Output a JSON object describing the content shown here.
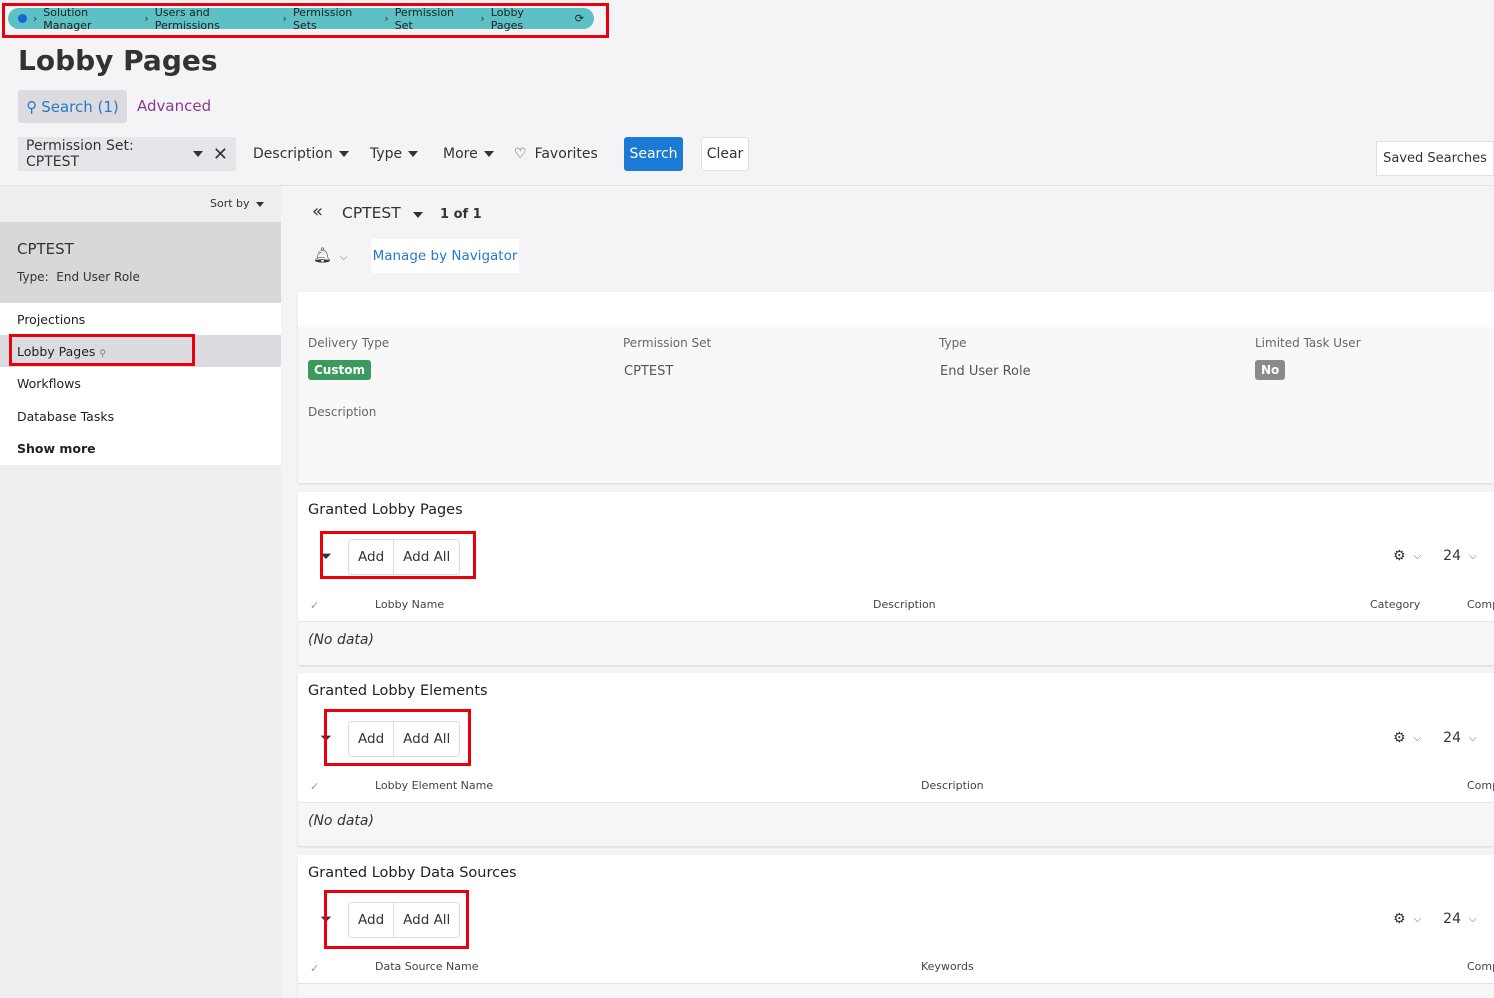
{
  "breadcrumb": [
    "Solution Manager",
    "Users and Permissions",
    "Permission Sets",
    "Permission Set",
    "Lobby Pages"
  ],
  "title": "Lobby Pages",
  "tabs": {
    "search": "Search (1)",
    "advanced": "Advanced"
  },
  "filters": {
    "permission_set": "Permission Set: CPTEST",
    "description": "Description",
    "type": "Type",
    "more": "More",
    "favorites": "Favorites",
    "search": "Search",
    "clear": "Clear",
    "saved": "Saved Searches"
  },
  "sidebar": {
    "sort_by": "Sort by",
    "selected": {
      "title": "CPTEST",
      "type_label": "Type:",
      "type_value": "End User Role"
    },
    "items": [
      "Projections",
      "Lobby Pages",
      "Workflows",
      "Database Tasks"
    ],
    "show_more": "Show more"
  },
  "record": {
    "name": "CPTEST",
    "count": "1 of 1",
    "manage": "Manage by Navigator"
  },
  "details": {
    "delivery_type_label": "Delivery Type",
    "delivery_type": "Custom",
    "permission_set_label": "Permission Set",
    "permission_set": "CPTEST",
    "type_label": "Type",
    "type": "End User Role",
    "limited_label": "Limited Task User",
    "limited": "No",
    "description_label": "Description"
  },
  "sections": [
    {
      "title": "Granted Lobby Pages",
      "add": "Add",
      "add_all": "Add All",
      "page_size": "24",
      "columns": [
        "Lobby Name",
        "Description",
        "Category",
        "Comp"
      ],
      "empty": "(No data)"
    },
    {
      "title": "Granted Lobby Elements",
      "add": "Add",
      "add_all": "Add All",
      "page_size": "24",
      "columns": [
        "Lobby Element Name",
        "Description",
        "Comp"
      ],
      "empty": "(No data)"
    },
    {
      "title": "Granted Lobby Data Sources",
      "add": "Add",
      "add_all": "Add All",
      "page_size": "24",
      "columns": [
        "Data Source Name",
        "Keywords",
        "Comp"
      ]
    }
  ],
  "colors": {
    "accent": "#1a7ad4",
    "badge_green": "#3c9a5f",
    "badge_gray": "#8a8a8a",
    "breadcrumb_bg": "#5dc0c4",
    "highlight": "#e8000b"
  }
}
